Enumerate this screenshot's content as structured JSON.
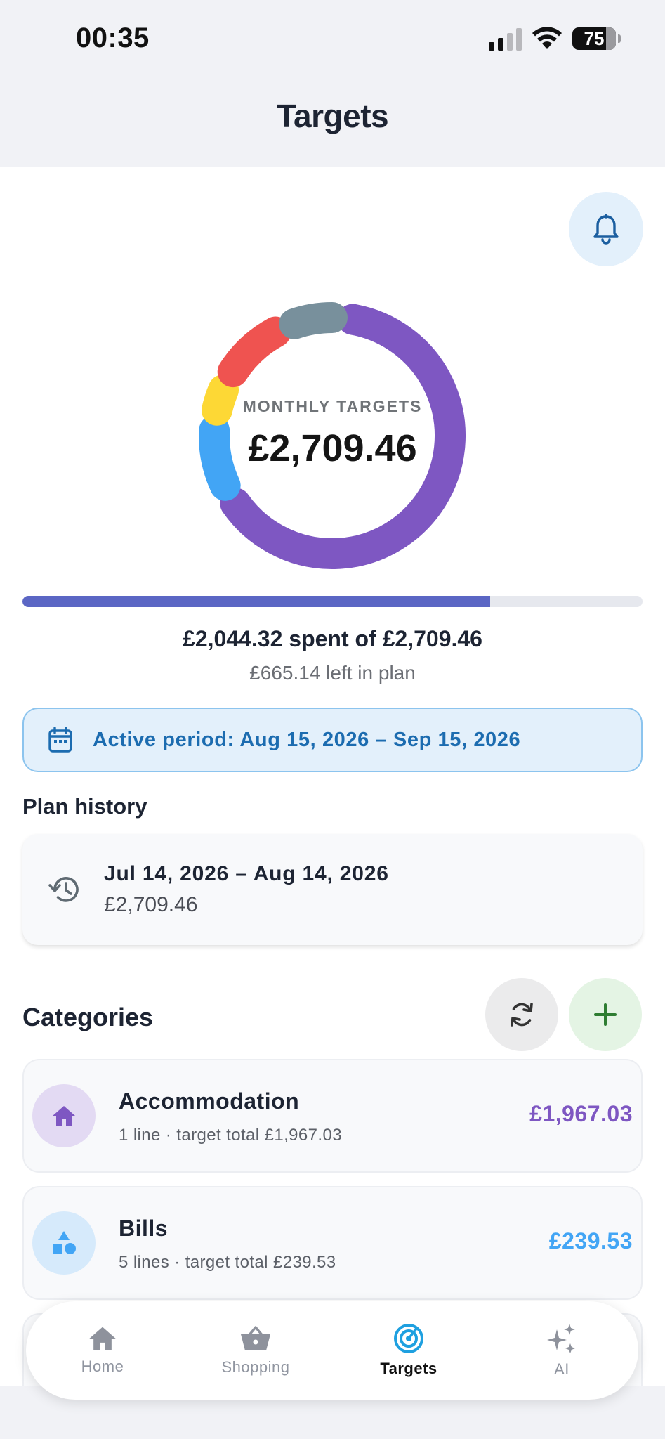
{
  "status_bar": {
    "time": "00:35",
    "battery": "75"
  },
  "header": {
    "title": "Targets"
  },
  "summary": {
    "donut_label": "MONTHLY TARGETS",
    "donut_value": "£2,709.46",
    "progress_fraction": 0.7545,
    "spent_text": "£2,044.32 spent of £2,709.46",
    "left_text": "£665.14 left in plan"
  },
  "donut_segments": [
    {
      "name": "Accommodation",
      "value": 1967.03,
      "color": "#7e57c2"
    },
    {
      "name": "Bills",
      "value": 239.53,
      "color": "#42a5f5"
    },
    {
      "name": "yellow-segment",
      "value": 90,
      "color": "#fdd835"
    },
    {
      "name": "red-segment",
      "value": 250,
      "color": "#ef5350"
    },
    {
      "name": "grey-segment",
      "value": 162.9,
      "color": "#78909c"
    }
  ],
  "period": {
    "text": "Active period: Aug 15, 2026 – Sep 15, 2026"
  },
  "plan_history": {
    "title": "Plan history",
    "items": [
      {
        "range": "Jul 14, 2026 – Aug 14, 2026",
        "amount": "£2,709.46"
      }
    ]
  },
  "categories": {
    "title": "Categories",
    "items": [
      {
        "name": "Accommodation",
        "subtitle": "1 line · target total £1,967.03",
        "amount": "£1,967.03",
        "color": "#7e57c2",
        "icon_bg": "#e3daf3",
        "icon": "home-icon"
      },
      {
        "name": "Bills",
        "subtitle": "5 lines · target total £239.53",
        "amount": "£239.53",
        "color": "#42a5f5",
        "icon_bg": "#d6eafb",
        "icon": "shapes-icon"
      }
    ]
  },
  "tabs": [
    {
      "label": "Home",
      "icon": "home-icon",
      "active": false
    },
    {
      "label": "Shopping",
      "icon": "basket-icon",
      "active": false
    },
    {
      "label": "Targets",
      "icon": "target-icon",
      "active": true
    },
    {
      "label": "AI",
      "icon": "sparkles-icon",
      "active": false
    }
  ]
}
